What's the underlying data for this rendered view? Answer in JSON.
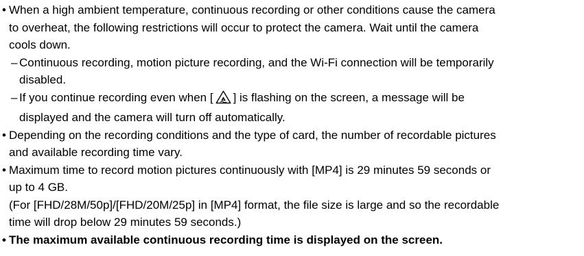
{
  "bullet_char": "•",
  "dash_char": "–",
  "items": {
    "overheat": {
      "lines": [
        "When a high ambient temperature, continuous recording or other conditions cause the camera",
        "to overheat, the following restrictions will occur to protect the camera. Wait until the camera",
        "cools down."
      ]
    },
    "sub1": {
      "lines": [
        "Continuous recording, motion picture recording, and the Wi-Fi connection will be temporarily",
        "disabled."
      ]
    },
    "sub2": {
      "line1_before": "If you continue recording even when [",
      "line1_after": "] is flashing on the screen, a message will be",
      "line2": "displayed and the camera will turn off automatically."
    },
    "conditions": {
      "lines": [
        "Depending on the recording conditions and the type of card, the number of recordable pictures",
        "and available recording time vary."
      ]
    },
    "maxtime": {
      "lines": [
        "Maximum time to record motion pictures continuously with [MP4] is 29 minutes 59 seconds or",
        "up to 4 GB."
      ]
    },
    "note": {
      "lines": [
        "(For [FHD/28M/50p]/[FHD/20M/25p] in [MP4] format, the file size is large and so the recordable",
        "time will drop below 29 minutes 59 seconds.)"
      ]
    },
    "bold_note": {
      "text": "The maximum available continuous recording time is displayed on the screen."
    }
  },
  "icons": {
    "overheat_warning": "overheat-warning-icon"
  }
}
